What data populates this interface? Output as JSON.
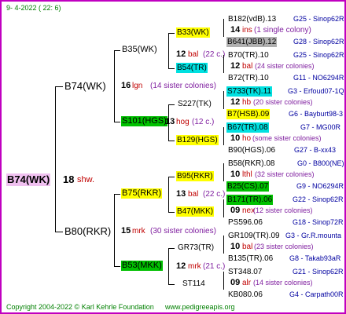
{
  "date": "9-  4-2022 ( 22:  6)",
  "root": {
    "name": "B74(WK)",
    "count": "18",
    "loc": "shw."
  },
  "gen1": [
    {
      "name": "B74(WK)",
      "count": "16",
      "loc": "lgn",
      "note": "(14 sister colonies)"
    },
    {
      "name": "B80(RKR)",
      "count": "15",
      "loc": "mrk",
      "note": "(30 sister colonies)"
    }
  ],
  "gen2": [
    {
      "name": "B35(WK)"
    },
    {
      "name": "S101(HGS)",
      "count": "13",
      "loc": "hog",
      "note": "(12 c.)"
    },
    {
      "name": "B75(RKR)",
      "count": "13",
      "loc": "bal",
      "note": "(22 c.)"
    },
    {
      "name": "B53(MKK)",
      "count": "12",
      "loc": "mrk",
      "note": "(21 c.)"
    }
  ],
  "gen3": [
    {
      "name": "B33(WK)",
      "count": "14",
      "loc": "ins",
      "note": "(1 single colony)"
    },
    {
      "name": "B54(TR)",
      "count": "12",
      "loc": "bal",
      "note": "(22 c.)"
    },
    {
      "name": "S227(TK)",
      "count": "12",
      "loc": "hb",
      "note": "(20 sister colonies)"
    },
    {
      "name": "B129(HGS)",
      "count": "10",
      "loc": "ho",
      "note": "(some sister colonies)"
    },
    {
      "name": "B95(RKR)",
      "count": "10",
      "loc": "lthl",
      "note": "(32 sister colonies)"
    },
    {
      "name": "B47(MKK)",
      "count": "09",
      "loc": "nex",
      "note": "(12 sister colonies)"
    },
    {
      "name": "GR73(TR)",
      "count": "10",
      "loc": "bal",
      "note": "(23 sister colonies)"
    },
    {
      "name": "ST114",
      "count": "09",
      "loc": "alr",
      "note": "(14 sister colonies)"
    }
  ],
  "gen4": [
    {
      "name": "B182(vdB).13",
      "ref": "G25 - Sinop62R"
    },
    {
      "name": "B641(JBB).12",
      "ref": "G28 - Sinop62R"
    },
    {
      "name": "B70(TR).10",
      "ref": "G25 - Sinop62R"
    },
    {
      "name": "B72(TR).10",
      "ref": "G11 - NO6294R"
    },
    {
      "name": "S733(TK).11",
      "ref": "G3 - Erfoud07-1Q"
    },
    {
      "name": "B7(HSB).09",
      "ref": "G6 - Bayburt98-3"
    },
    {
      "name": "B67(TR).08",
      "ref": "G7 - MG00R"
    },
    {
      "name": "B90(HGS).06",
      "ref": "G27 - B-xx43"
    },
    {
      "name": "B58(RKR).08",
      "ref": "G0 - B800(NE)"
    },
    {
      "name": "B25(CS).07",
      "ref": "G9 - NO6294R"
    },
    {
      "name": "B171(TR).06",
      "ref": "G22 - Sinop62R"
    },
    {
      "name": "PS596.06",
      "ref": "G18 - Sinop72R"
    },
    {
      "name": "GR109(TR).09",
      "ref": "G3 - Gr.R.mounta"
    },
    {
      "name": "B135(TR).06",
      "ref": "G8 - Takab93aR"
    },
    {
      "name": "ST348.07",
      "ref": "G21 - Sinop62R"
    },
    {
      "name": "KB080.06",
      "ref": "G4 - Carpath00R"
    }
  ],
  "footer": {
    "copyright": "Copyright 2004-2022 © Karl Kehrle Foundation",
    "url": "www.pedigreeapis.org"
  },
  "colors": {
    "frame": "#c000c0",
    "root_bg": "#f0c0f0",
    "yellow": "#ffff00",
    "cyan": "#00e0e0",
    "green": "#00c000",
    "gray": "#b0b0b0"
  }
}
